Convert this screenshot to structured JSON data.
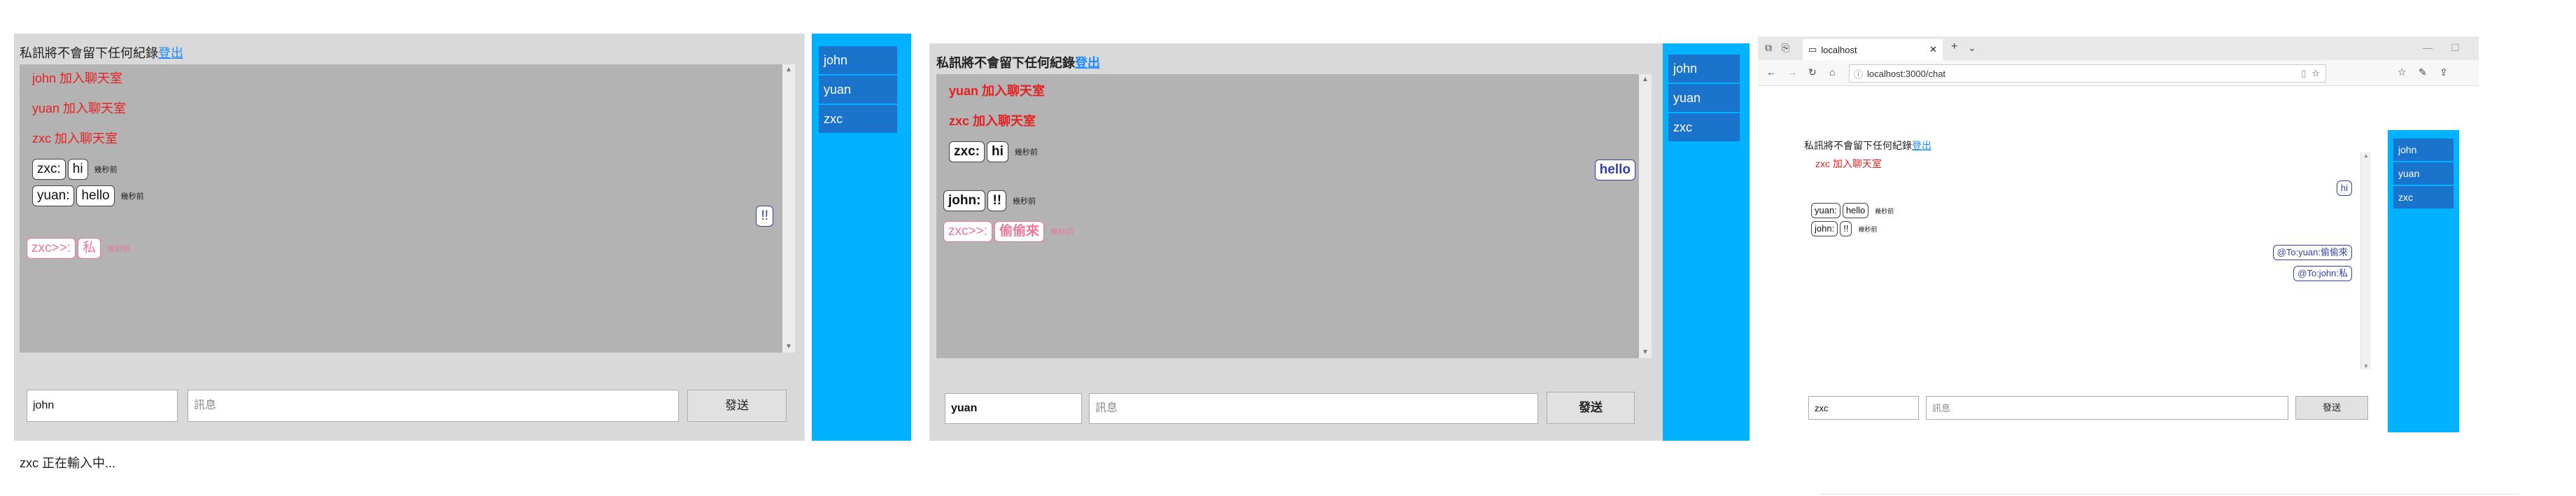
{
  "w1": {
    "header_text": "私訊將不會留下任何紀錄",
    "logout_label": "登出",
    "system_messages": [
      "john 加入聊天室",
      "yuan 加入聊天室",
      "zxc 加入聊天室"
    ],
    "messages": [
      {
        "name": "zxc:",
        "text": "hi",
        "time": "幾秒前"
      },
      {
        "name": "yuan:",
        "text": "hello",
        "time": "幾秒前"
      }
    ],
    "right_message": "!!",
    "private_message": {
      "name": "zxc>>:",
      "text": "私",
      "time": "幾秒前"
    },
    "name_input_value": "john",
    "message_placeholder": "訊息",
    "send_label": "發送",
    "users": [
      "john",
      "yuan",
      "zxc"
    ],
    "typing_status": "zxc 正在輸入中..."
  },
  "w2": {
    "header_text": "私訊將不會留下任何紀錄",
    "logout_label": "登出",
    "system_messages": [
      "yuan 加入聊天室",
      "zxc 加入聊天室"
    ],
    "messages": [
      {
        "name": "zxc:",
        "text": "hi",
        "time": "幾秒前"
      }
    ],
    "right_message": "hello",
    "messages2": [
      {
        "name": "john:",
        "text": "!!",
        "time": "幾秒前"
      }
    ],
    "private_message": {
      "name": "zxc>>:",
      "text": "偷偷來",
      "time": "幾秒前"
    },
    "name_input_value": "yuan",
    "message_placeholder": "訊息",
    "send_label": "發送",
    "users": [
      "john",
      "yuan",
      "zxc"
    ]
  },
  "w3": {
    "browser": {
      "tab_title": "localhost",
      "url": "localhost:3000/chat"
    },
    "header_text": "私訊將不會留下任何紀錄",
    "logout_label": "登出",
    "system_messages": [
      "zxc 加入聊天室"
    ],
    "right_message": "hi",
    "messages": [
      {
        "name": "yuan:",
        "text": "hello",
        "time": "幾秒前"
      },
      {
        "name": "john:",
        "text": "!!",
        "time": "幾秒前"
      }
    ],
    "sent_private": [
      "@To:yuan:偷偷來",
      "@To:john:私"
    ],
    "name_input_value": "zxc",
    "message_placeholder": "訊息",
    "send_label": "發送",
    "users": [
      "john",
      "yuan",
      "zxc"
    ]
  },
  "colors": {
    "panel": "#d9d9d9",
    "chat_bg": "#b3b3b3",
    "sidebar": "#00b2ff",
    "user_item": "#1a74cc",
    "system_text": "#e62020",
    "private": "#e8789a",
    "own_message": "#3340aa",
    "link": "#1a8cff"
  }
}
